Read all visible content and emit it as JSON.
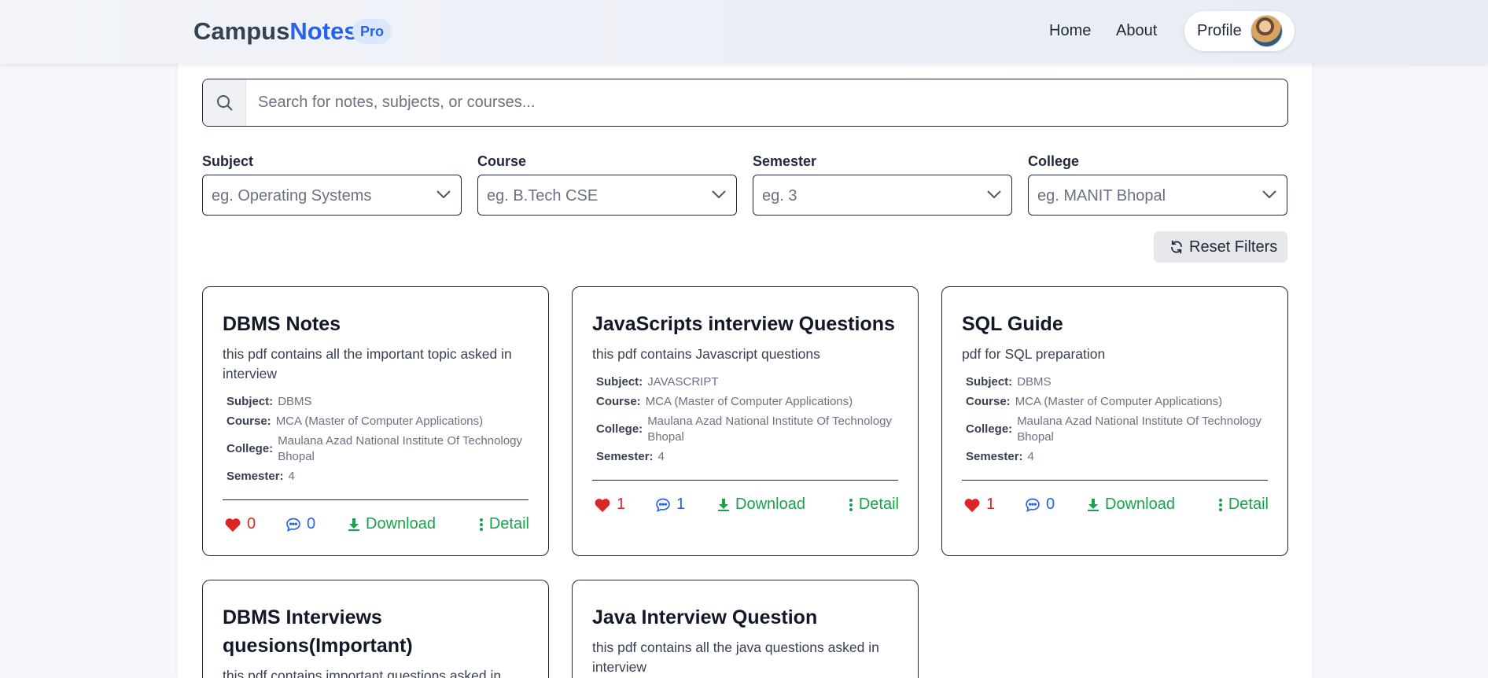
{
  "navbar": {
    "brand_part1": "Campus",
    "brand_part2": "Notes",
    "badge": "Pro",
    "links": [
      "Home",
      "About"
    ],
    "profile_label": "Profile"
  },
  "search": {
    "placeholder": "Search for notes, subjects, or courses..."
  },
  "filters": [
    {
      "label": "Subject",
      "placeholder": "eg. Operating Systems"
    },
    {
      "label": "Course",
      "placeholder": "eg. B.Tech CSE"
    },
    {
      "label": "Semester",
      "placeholder": "eg. 3"
    },
    {
      "label": "College",
      "placeholder": "eg. MANIT Bhopal"
    }
  ],
  "reset_label": "Reset Filters",
  "meta_keys": {
    "subject": "Subject:",
    "course": "Course:",
    "college": "College:",
    "semester": "Semester:"
  },
  "actions": {
    "download": "Download",
    "detail": "Detail"
  },
  "colors": {
    "brand_blue": "#2563eb",
    "like_red": "#dc2626",
    "action_green": "#16a34a"
  },
  "cards": [
    {
      "title": "DBMS Notes",
      "description": "this pdf contains all the important topic asked in interview",
      "subject": "DBMS",
      "course": "MCA (Master of Computer Applications)",
      "college": "Maulana Azad National Institute Of Technology Bhopal",
      "semester": "4",
      "likes": "0",
      "comments": "0"
    },
    {
      "title": "JavaScripts interview Questions",
      "description": "this pdf contains Javascript questions",
      "subject": "JAVASCRIPT",
      "course": "MCA (Master of Computer Applications)",
      "college": "Maulana Azad National Institute Of Technology Bhopal",
      "semester": "4",
      "likes": "1",
      "comments": "1"
    },
    {
      "title": "SQL Guide",
      "description": "pdf for SQL preparation",
      "subject": "DBMS",
      "course": "MCA (Master of Computer Applications)",
      "college": "Maulana Azad National Institute Of Technology Bhopal",
      "semester": "4",
      "likes": "1",
      "comments": "0"
    },
    {
      "title": "DBMS Interviews quesions(Important)",
      "description": "this pdf contains important questions asked in"
    },
    {
      "title": "Java Interview Question",
      "description": "this pdf contains all the java questions asked in interview"
    }
  ]
}
